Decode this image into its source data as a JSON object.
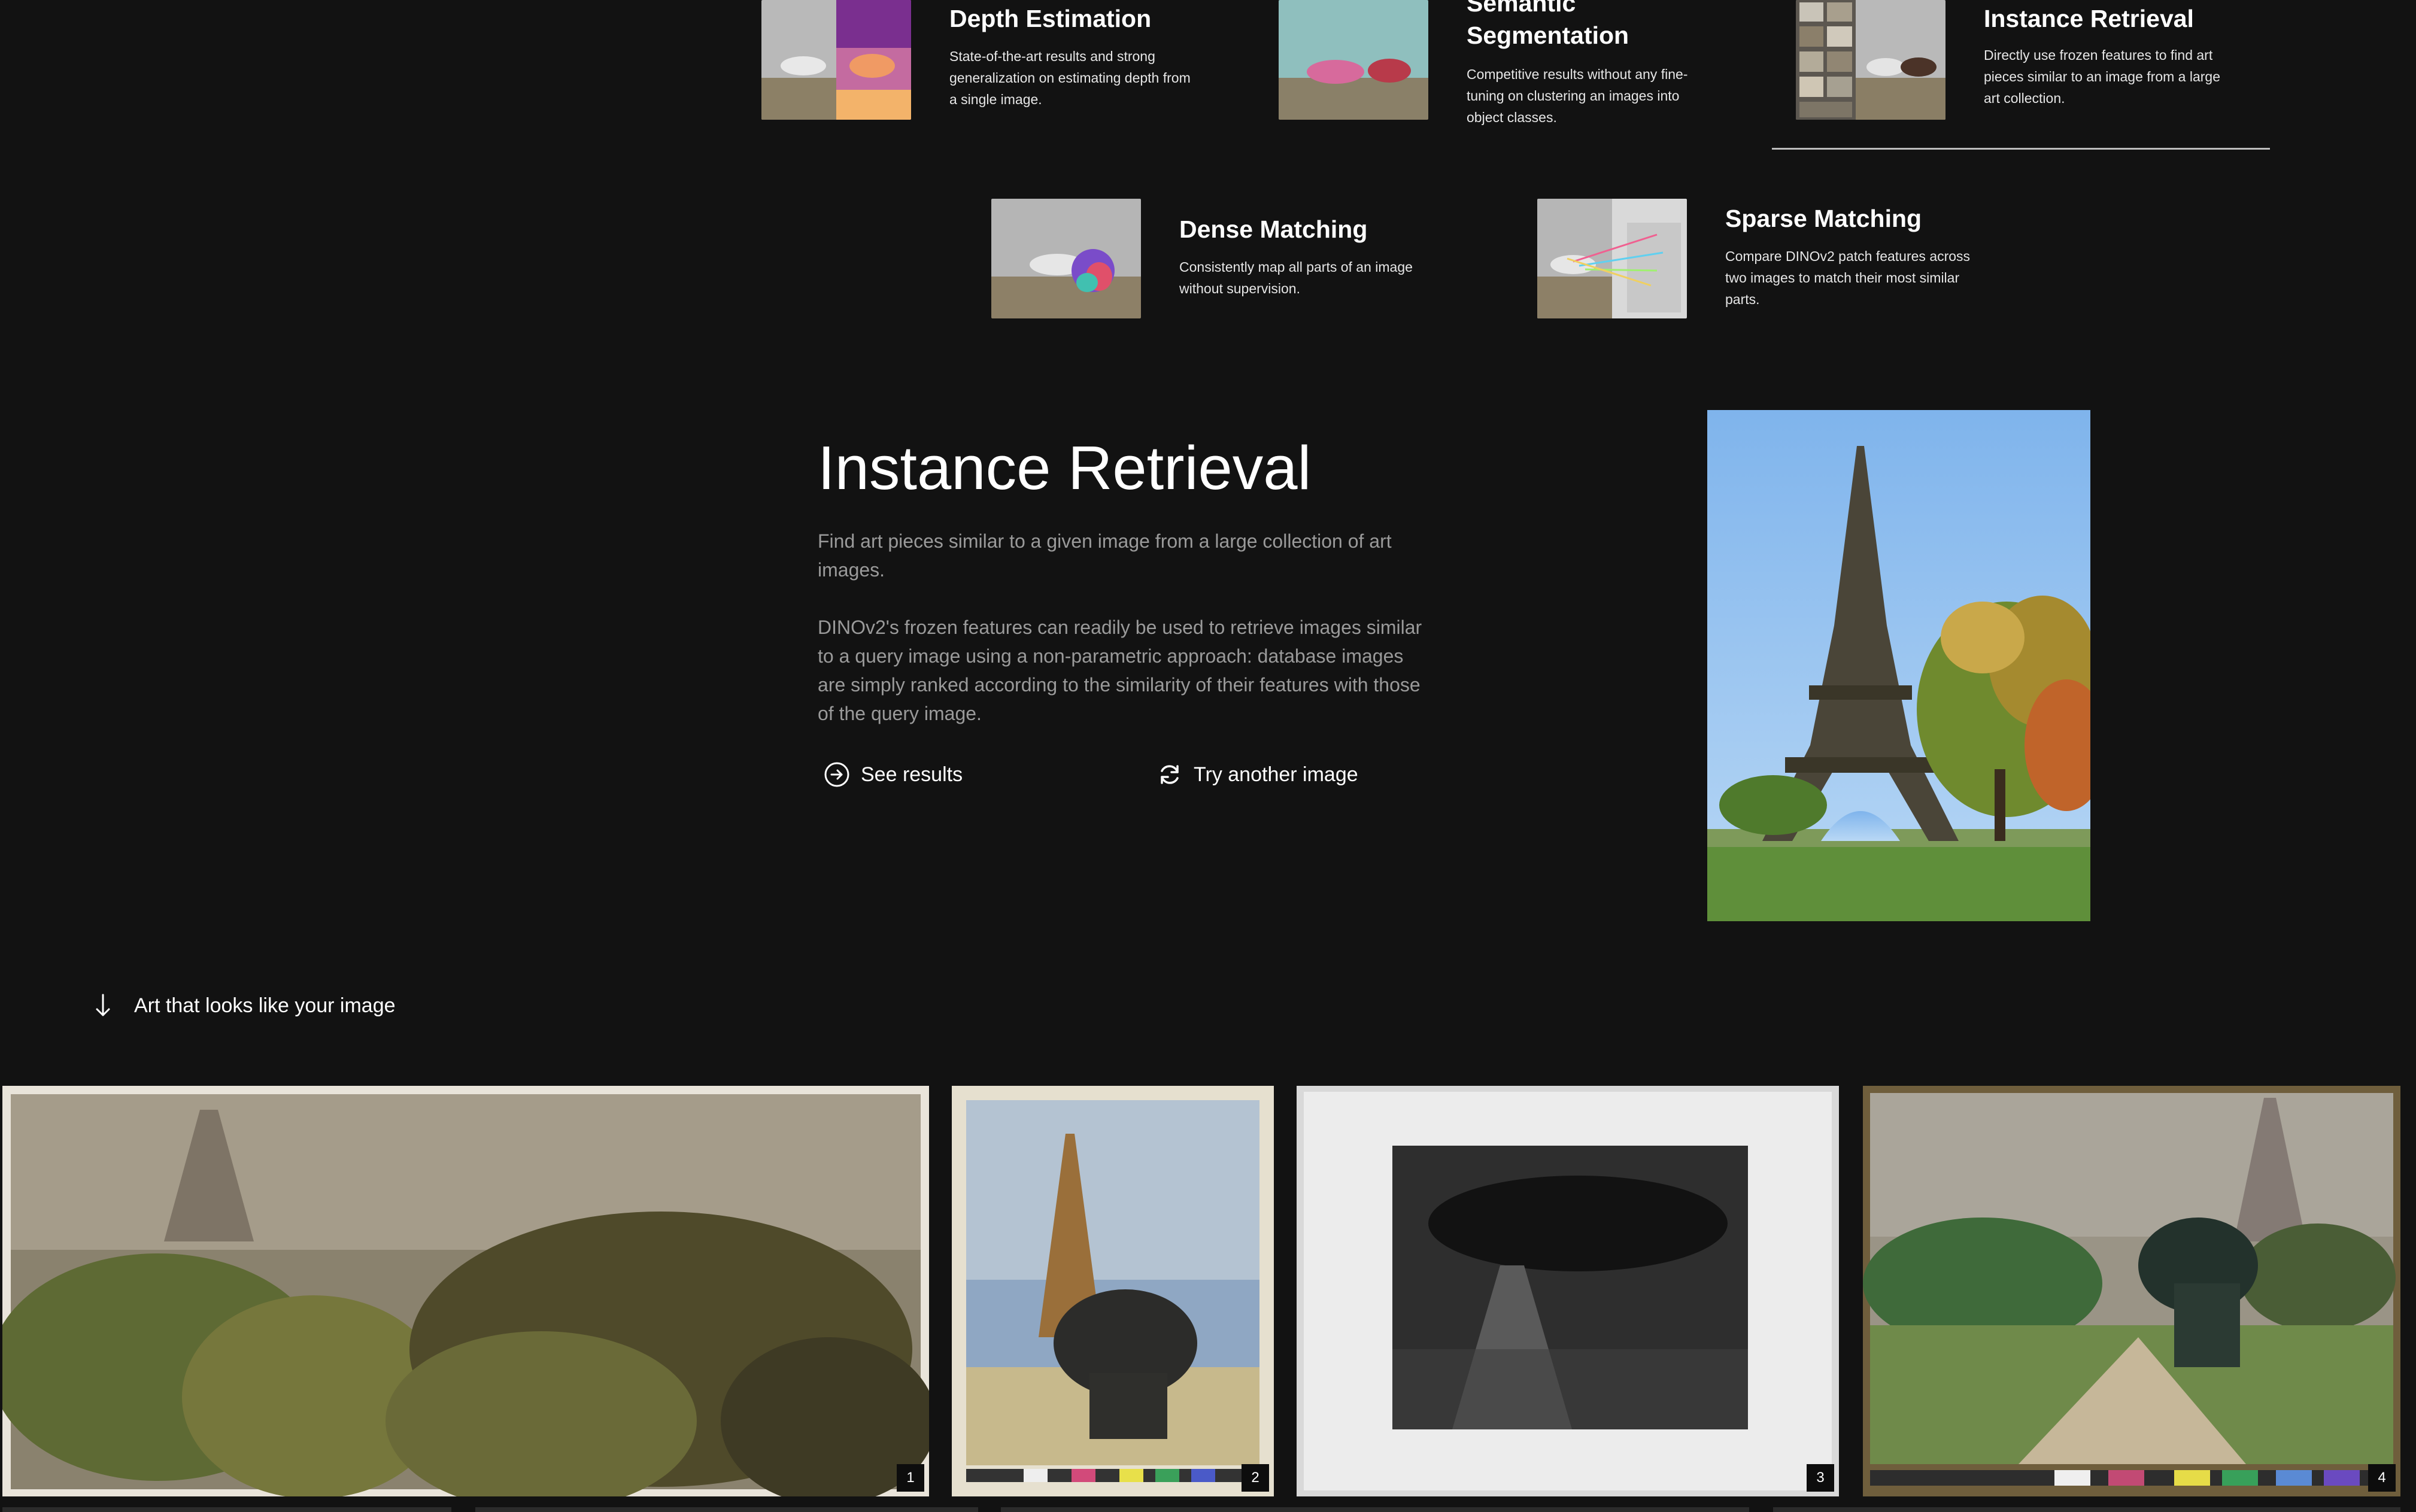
{
  "features": [
    {
      "title": "Depth Estimation",
      "description": "State-of-the-art results and strong generalization on estimating depth from a single image."
    },
    {
      "title": "Semantic Segmentation",
      "description": "Competitive results without any fine-tuning on clustering an images into object classes."
    },
    {
      "title": "Instance Retrieval",
      "description": "Directly use frozen features to find art pieces similar to an image from a large art collection."
    },
    {
      "title": "Dense Matching",
      "description": "Consistently map all parts of an image without supervision."
    },
    {
      "title": "Sparse Matching",
      "description": "Compare DINOv2 patch features across two images to match their most similar parts."
    }
  ],
  "retrieval": {
    "title": "Instance Retrieval",
    "intro": "Find art pieces similar to a given image from a large collection of art images.",
    "body": "DINOv2's frozen features can readily be used to retrieve images similar to a query image using a non-parametric approach: database images are simply ranked according to the similarity of their features with those of the query image.",
    "see_results_label": "See results",
    "try_another_label": "Try another image"
  },
  "results": {
    "heading": "Art that looks like your image",
    "ranks": [
      "1",
      "2",
      "3",
      "4"
    ]
  },
  "icons": {
    "see_results": "arrow-circle-right-icon",
    "try_another": "refresh-icon",
    "results_heading": "arrow-down-icon"
  },
  "colors": {
    "background": "#121212",
    "text": "#ffffff",
    "muted_text": "#9a9a9a"
  }
}
